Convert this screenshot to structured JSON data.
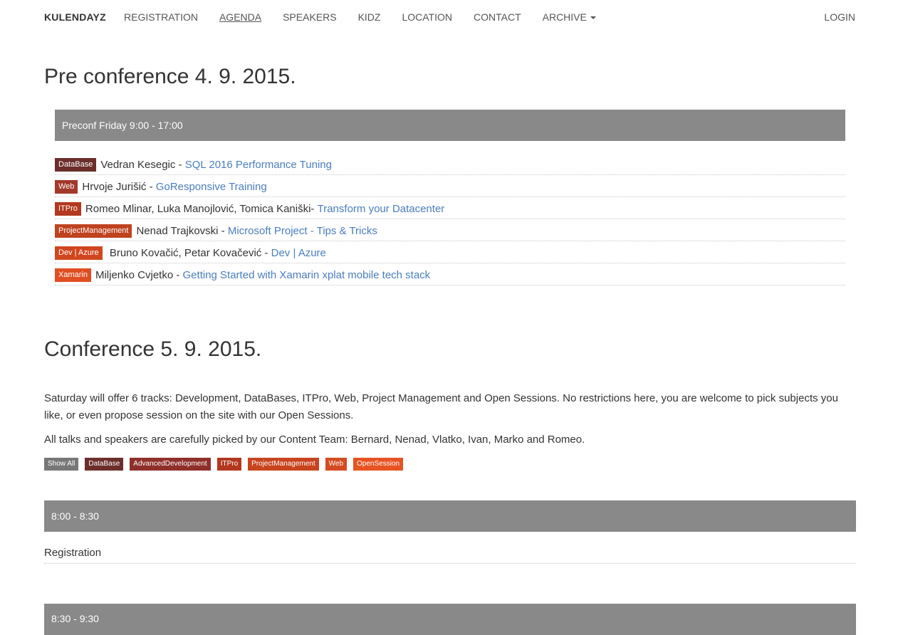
{
  "nav": {
    "brand": "KULENDAYZ",
    "items": [
      {
        "label": "REGISTRATION"
      },
      {
        "label": "AGENDA",
        "active": true
      },
      {
        "label": "SPEAKERS"
      },
      {
        "label": "KIDZ"
      },
      {
        "label": "LOCATION"
      },
      {
        "label": "CONTACT"
      },
      {
        "label": "ARCHIVE",
        "dropdown": true
      }
    ],
    "login": "LOGIN"
  },
  "preconference": {
    "title": "Pre conference 4. 9. 2015.",
    "slot": "Preconf Friday 9:00 - 17:00",
    "sessions": [
      {
        "tag": "DataBase",
        "tag_color": "#6b2e2a",
        "speakers": "Vedran Kesegic - ",
        "title": "SQL 2016 Performance Tuning"
      },
      {
        "tag": "Web",
        "tag_color": "#a3382b",
        "speakers": "Hrvoje Jurišić - ",
        "title": "GoResponsive Training"
      },
      {
        "tag": "ITPro",
        "tag_color": "#b3381f",
        "speakers": "Romeo Mlinar, Luka Manojlović, Tomica Kaniški- ",
        "title": "Transform your Datacenter"
      },
      {
        "tag": "ProjectManagement",
        "tag_color": "#c0431f",
        "speakers": "Nenad Trajkovski - ",
        "title": "Microsoft Project - Tips & Tricks"
      },
      {
        "tag": "Dev | Azure",
        "tag_color": "#d1461f",
        "speakers": "Bruno Kovačić, Petar Kovačević - ",
        "title": "Dev | Azure"
      },
      {
        "tag": "Xamarin",
        "tag_color": "#e04e22",
        "speakers": "Miljenko Cvjetko - ",
        "title": "Getting Started with Xamarin xplat mobile tech stack"
      }
    ]
  },
  "conference": {
    "title": "Conference 5. 9. 2015.",
    "intro": "Saturday will offer 6 tracks: Development, DataBases, ITPro, Web, Project Management and Open Sessions. No restrictions here, you are welcome to pick subjects you like, or even propose session on the site with our Open Sessions.",
    "team": "All talks and speakers are carefully picked by our Content Team: Bernard, Nenad, Vlatko, Ivan, Marko and Romeo.",
    "filters": [
      {
        "label": "Show All",
        "color": "#777777"
      },
      {
        "label": "DataBase",
        "color": "#6b2e2a"
      },
      {
        "label": "AdvancedDevelopment",
        "color": "#8f2f2a"
      },
      {
        "label": "ITPro",
        "color": "#b3381f"
      },
      {
        "label": "ProjectManagement",
        "color": "#c8441f"
      },
      {
        "label": "Web",
        "color": "#d54a20"
      },
      {
        "label": "OpenSession",
        "color": "#e75322"
      }
    ],
    "slots": [
      {
        "time": "8:00 - 8:30",
        "item": "Registration"
      },
      {
        "time": "8:30 - 9:30"
      }
    ]
  }
}
